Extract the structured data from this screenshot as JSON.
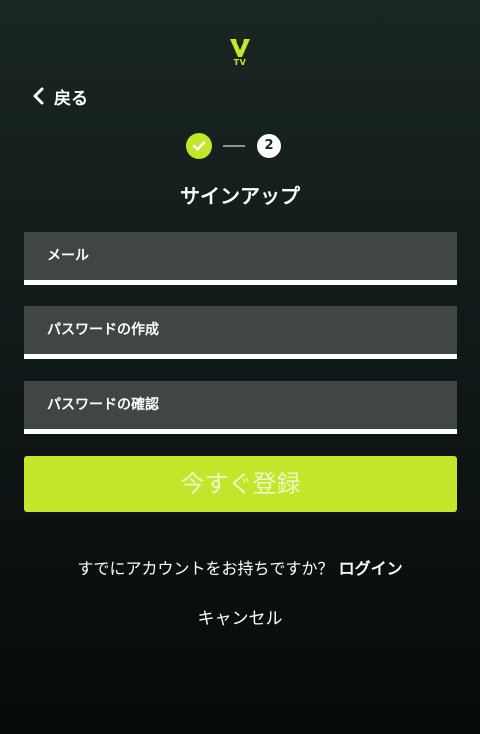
{
  "header": {
    "logo_text": "TV",
    "back_label": "戻る"
  },
  "stepper": {
    "current_step": "2",
    "completed_steps": 1
  },
  "page": {
    "title": "サインアップ"
  },
  "form": {
    "email_placeholder": "メール",
    "password_placeholder": "パスワードの作成",
    "confirm_placeholder": "パスワードの確認",
    "email_value": "",
    "password_value": "",
    "confirm_value": "",
    "submit_label": "今すぐ登録"
  },
  "footer": {
    "login_prompt": "すでにアカウントをお持ちですか？ ",
    "login_link": "ログイン",
    "cancel_label": "キャンセル"
  },
  "colors": {
    "accent": "#c3e62a",
    "field_bg": "#3f4645",
    "background_top": "#1a2624",
    "background_bottom": "#070a0a"
  }
}
